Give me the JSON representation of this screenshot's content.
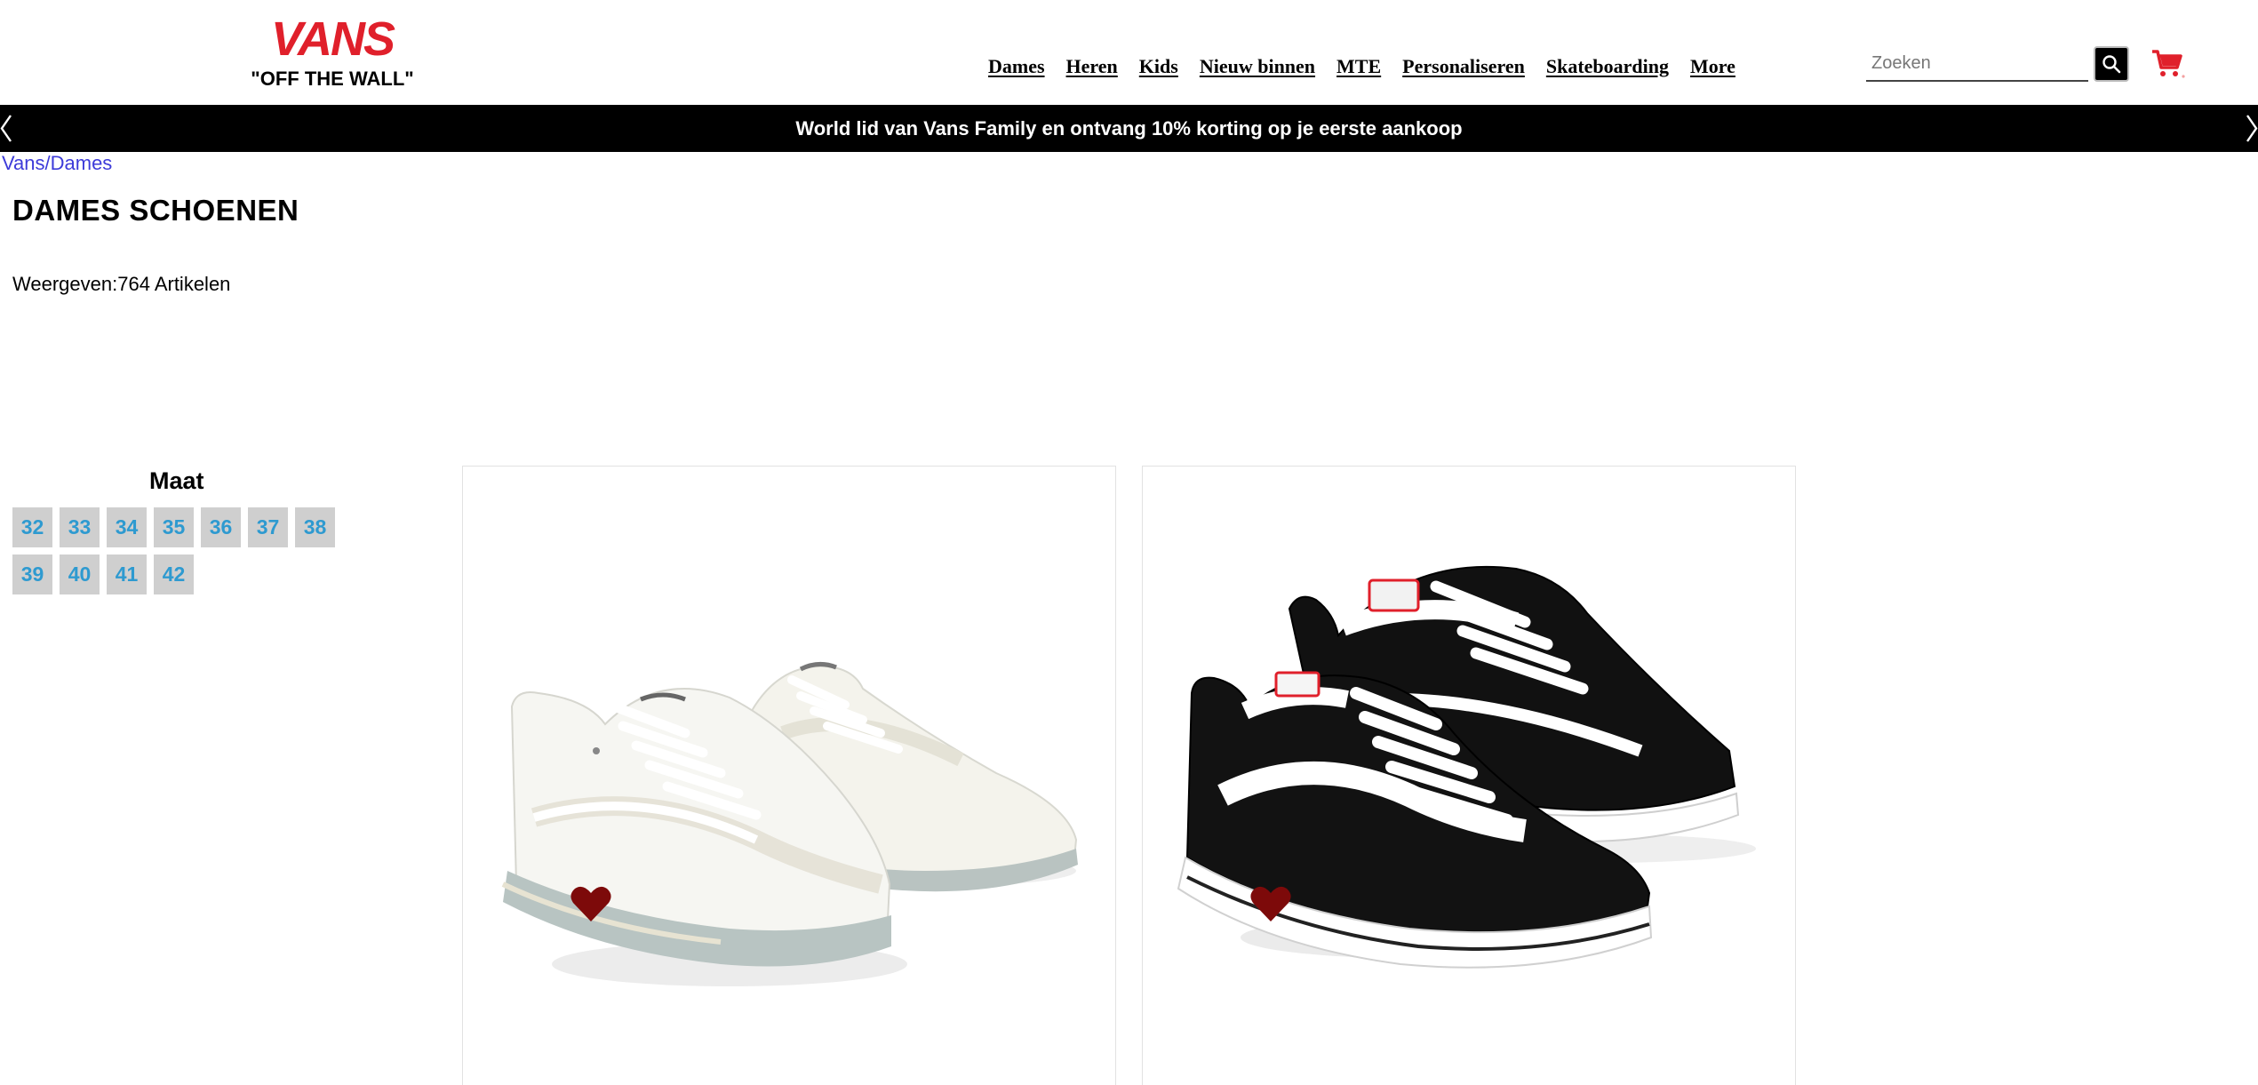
{
  "brand": {
    "name": "VANS",
    "tagline": "\"OFF THE WALL\"",
    "color": "#e0202b"
  },
  "nav": {
    "items": [
      {
        "label": "Dames"
      },
      {
        "label": "Heren"
      },
      {
        "label": "Kids"
      },
      {
        "label": "Nieuw binnen"
      },
      {
        "label": "MTE"
      },
      {
        "label": "Personaliseren"
      },
      {
        "label": "Skateboarding"
      },
      {
        "label": "More"
      }
    ]
  },
  "search": {
    "placeholder": "Zoeken",
    "value": "",
    "icon": "search-icon"
  },
  "cart": {
    "icon": "shopping-cart-icon",
    "color": "#e0202b"
  },
  "promo": {
    "text": "World lid van Vans Family en ontvang 10% korting op je eerste aankoop"
  },
  "breadcrumb": {
    "text": "Vans/Dames"
  },
  "page": {
    "title": "DAMES SCHOENEN",
    "count_text": "Weergeven:764 Artikelen"
  },
  "filter": {
    "title": "Maat",
    "sizes": [
      "32",
      "33",
      "34",
      "35",
      "36",
      "37",
      "38",
      "39",
      "40",
      "41",
      "42"
    ]
  },
  "products": [
    {
      "colorway": "white",
      "wishlist_icon": "heart-icon",
      "heart_color": "#7d0a0a"
    },
    {
      "colorway": "black/white",
      "wishlist_icon": "heart-icon",
      "heart_color": "#7d0a0a"
    }
  ]
}
